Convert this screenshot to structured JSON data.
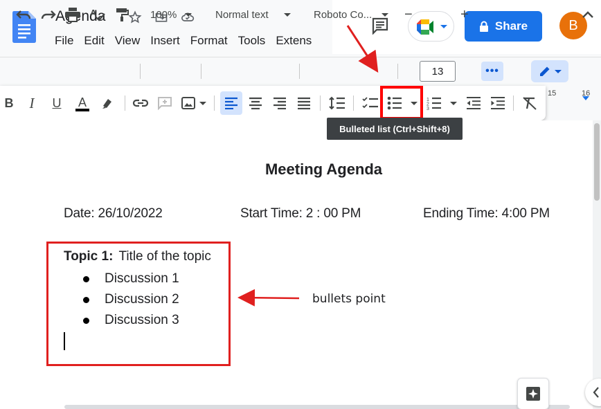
{
  "document": {
    "title": "Agenda",
    "menu": [
      "File",
      "Edit",
      "View",
      "Insert",
      "Format",
      "Tools",
      "Extens"
    ]
  },
  "header": {
    "share_label": "Share",
    "avatar_initial": "B"
  },
  "toolbar": {
    "zoom": "100%",
    "style": "Normal text",
    "font": "Roboto Co...",
    "font_size": "13",
    "ruler_marks": [
      "15",
      "16"
    ]
  },
  "tooltip": "Bulleted list (Ctrl+Shift+8)",
  "content": {
    "heading": "Meeting Agenda",
    "date": "Date: 26/10/2022",
    "start_time": "Start Time: 2 : 00 PM",
    "end_time": "Ending Time: 4:00 PM",
    "topic_label": "Topic 1:",
    "topic_title": "Title of the topic",
    "bullets": [
      "Discussion 1",
      "Discussion 2",
      "Discussion 3"
    ]
  },
  "annotation": {
    "label": "bullets point",
    "color": "#e0201f"
  },
  "colors": {
    "share_button": "#1a73e8",
    "avatar": "#e8710a",
    "active_button": "#d3e3fd",
    "docs_blue": "#4285f4"
  }
}
